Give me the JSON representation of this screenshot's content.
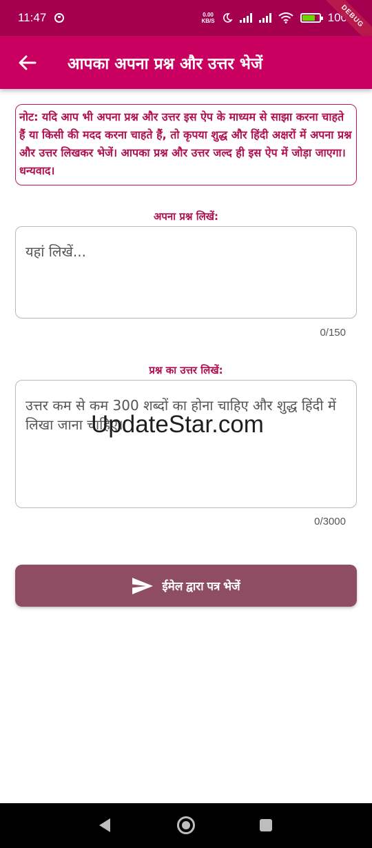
{
  "status_bar": {
    "time": "11:47",
    "net_speed_value": "0.00",
    "net_speed_unit": "KB/S",
    "battery": "100",
    "debug_label": "DEBUG"
  },
  "app_bar": {
    "title": "आपका अपना प्रश्न और उत्तर भेजें"
  },
  "note": {
    "text": "नोट: यदि आप भी अपना प्रश्न और उत्तर इस ऐप के माध्यम से साझा करना चाहते हैं या किसी की मदद करना चाहते हैं, तो कृपया शुद्ध और हिंदी अक्षरों में अपना प्रश्न और उत्तर लिखकर भेजें। आपका प्रश्न और उत्तर जल्द ही इस ऐप में जोड़ा जाएगा। धन्यवाद।"
  },
  "question": {
    "label": "अपना प्रश्न लिखें:",
    "placeholder": "यहां लिखें...",
    "value": "",
    "counter": "0/150"
  },
  "answer": {
    "label": "प्रश्न का उत्तर लिखें:",
    "placeholder": "उत्तर कम से कम 300 शब्दों का होना चाहिए और शुद्ध हिंदी में लिखा जाना चाहिए।",
    "value": "",
    "counter": "0/3000"
  },
  "send_button": {
    "label": "ईमेल द्वारा पत्र भेजें"
  },
  "watermark": "UpdateStar.com",
  "colors": {
    "status_bar": "#a5004f",
    "app_bar": "#c9005f",
    "accent_text": "#b0104f",
    "button": "#8e4d63"
  }
}
